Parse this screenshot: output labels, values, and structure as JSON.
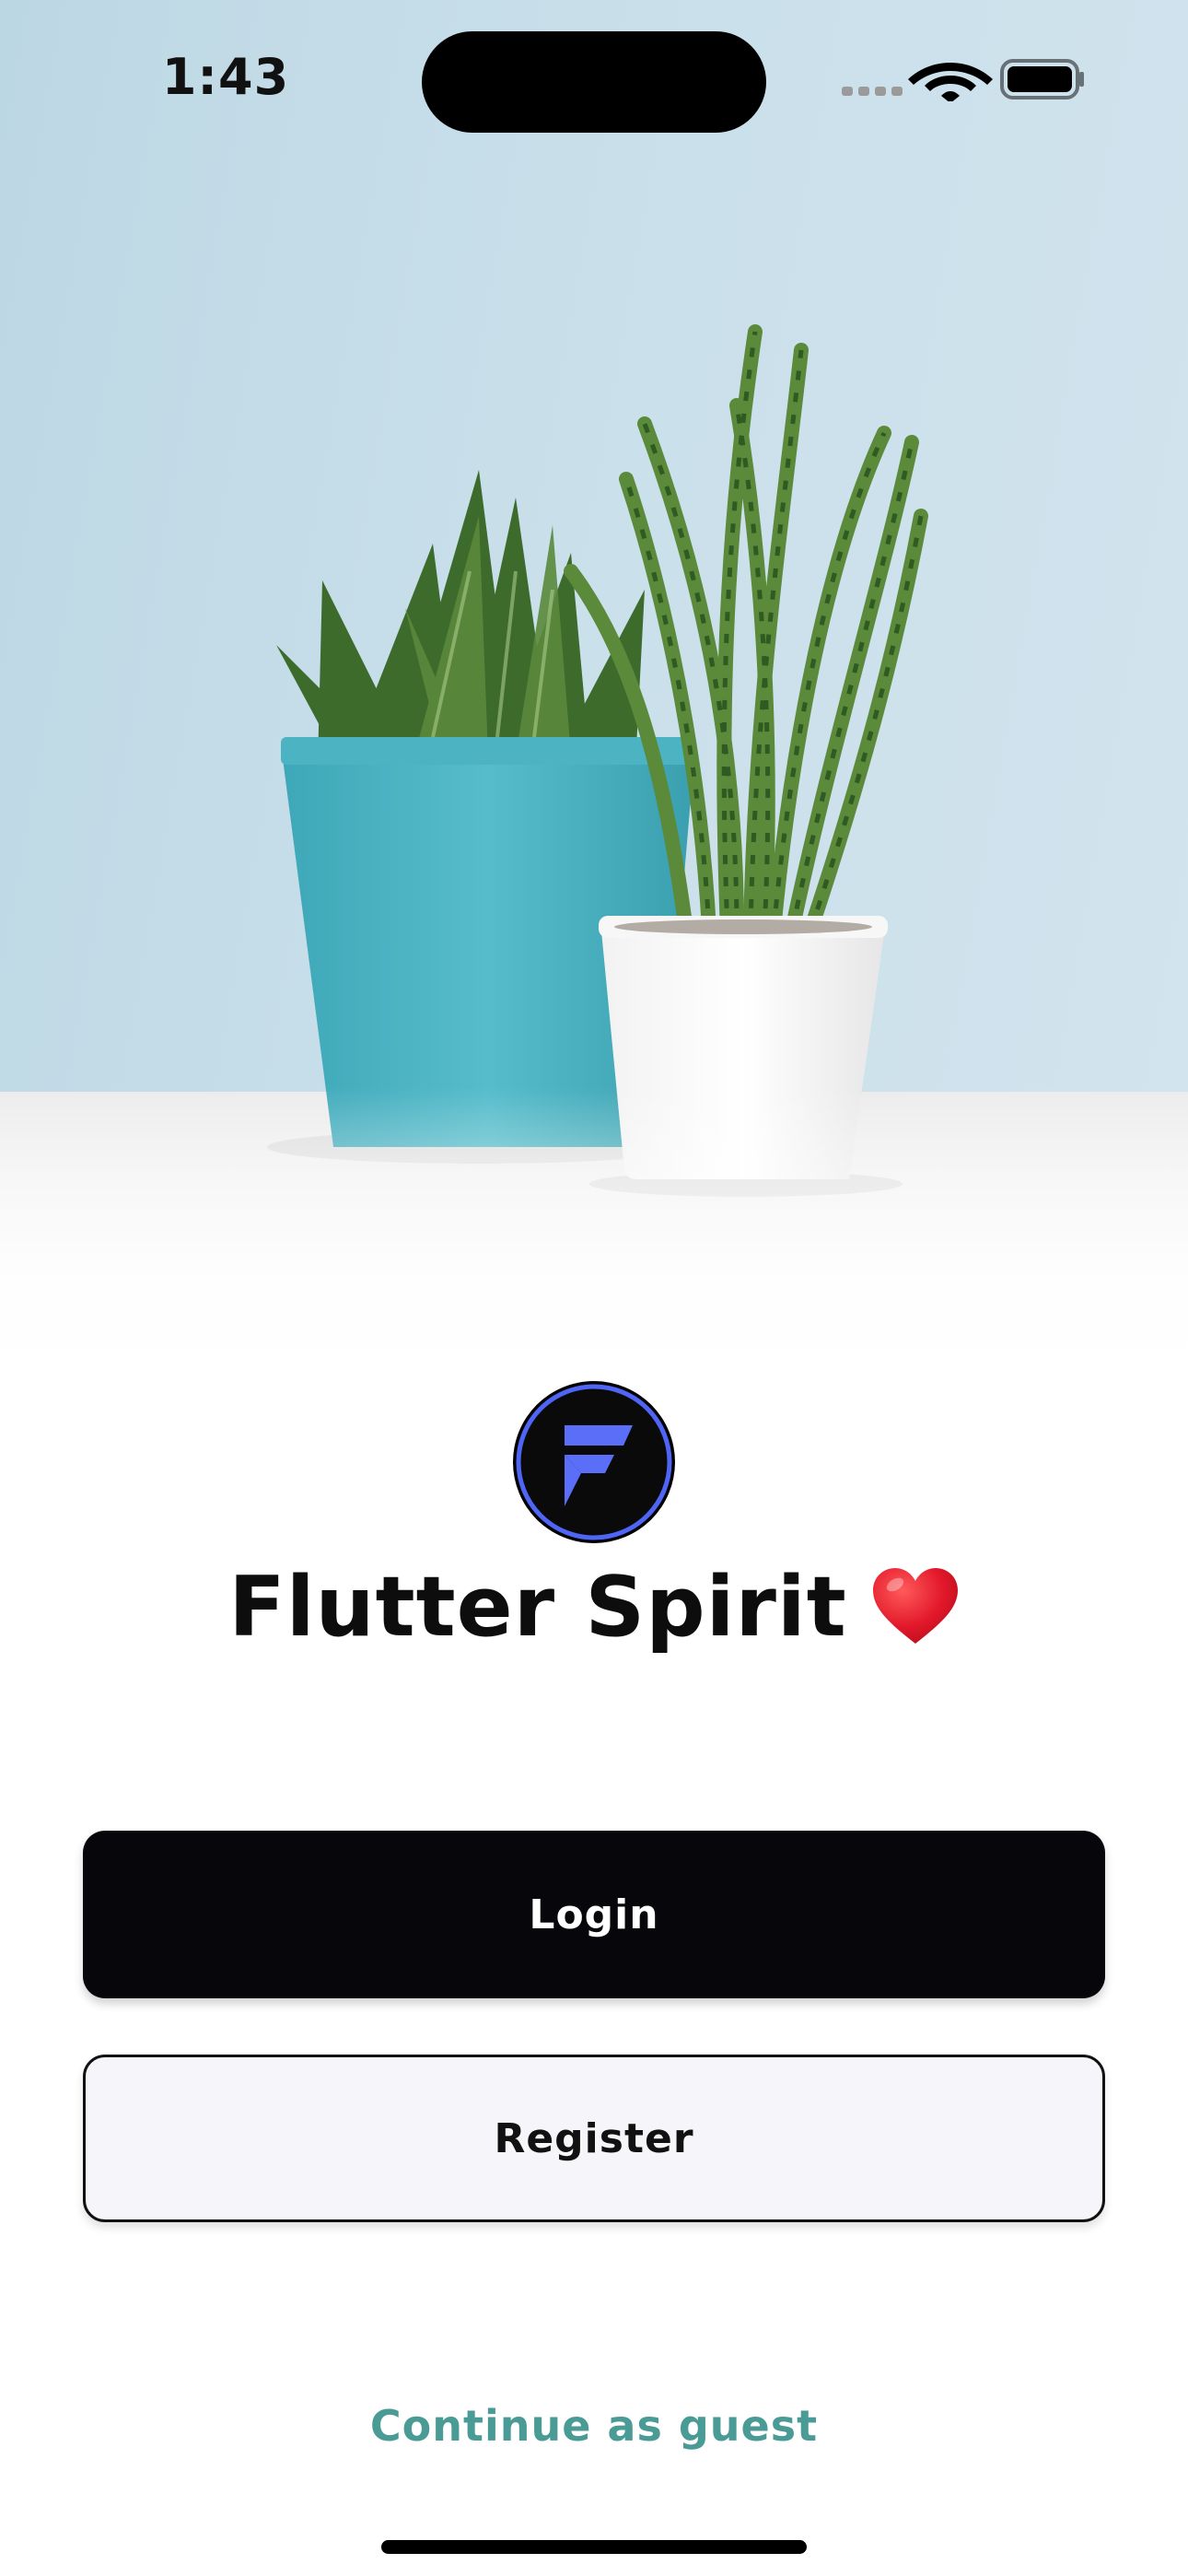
{
  "status_bar": {
    "time": "1:43",
    "icons": [
      "cellular-icon",
      "wifi-icon",
      "battery-icon"
    ]
  },
  "hero": {
    "image": "potted-plants-photo"
  },
  "brand": {
    "logo": "flutter-spirit-logo",
    "title": "Flutter Spirit",
    "emoji": "heart-icon",
    "logo_colors": {
      "ring": "#4e65f5",
      "fill": "#0a0a0a",
      "letter": "#5b6ef7"
    }
  },
  "actions": {
    "login_label": "Login",
    "register_label": "Register",
    "guest_label": "Continue as guest"
  },
  "colors": {
    "primary_button": "#07070b",
    "secondary_button": "#f5f5fa",
    "link": "#4a9a96"
  }
}
